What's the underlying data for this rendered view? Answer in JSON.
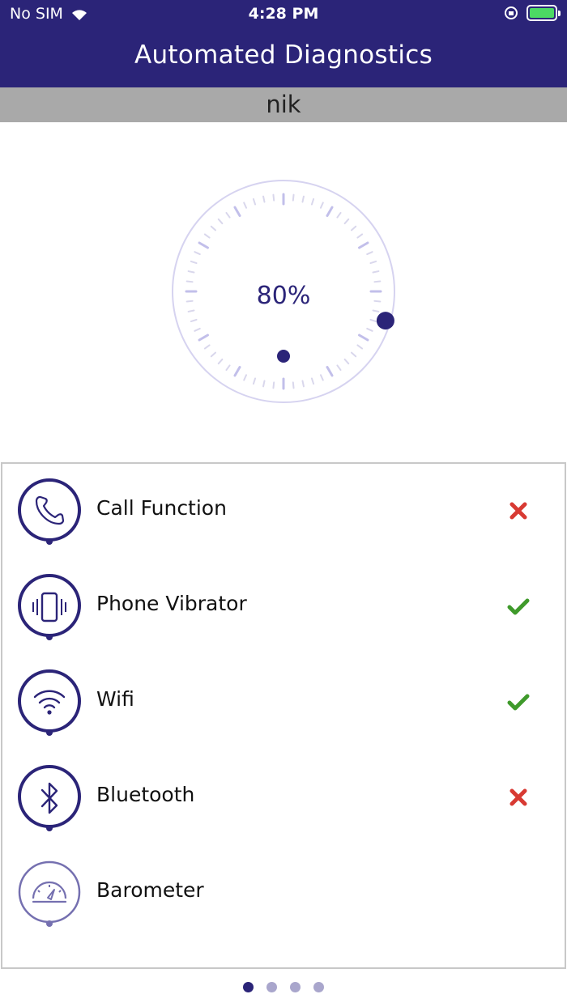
{
  "status_bar": {
    "carrier": "No SIM",
    "time": "4:28 PM"
  },
  "header": {
    "title": "Automated Diagnostics"
  },
  "user": {
    "name": "nik"
  },
  "gauge": {
    "label": "80%",
    "value": 80,
    "color": "#2b2478"
  },
  "tests": [
    {
      "label": "Call Function",
      "icon": "phone-icon",
      "status": "fail"
    },
    {
      "label": "Phone Vibrator",
      "icon": "vibrate-icon",
      "status": "pass"
    },
    {
      "label": "Wifi",
      "icon": "wifi-icon",
      "status": "pass"
    },
    {
      "label": "Bluetooth",
      "icon": "bluetooth-icon",
      "status": "fail"
    },
    {
      "label": "Barometer",
      "icon": "barometer-icon",
      "status": "pending"
    }
  ],
  "pager": {
    "total": 4,
    "active": 0
  },
  "colors": {
    "header": "#2b2478",
    "user_bar": "#a9a9a9",
    "pass": "#3f9a2b",
    "fail": "#d83a33"
  }
}
